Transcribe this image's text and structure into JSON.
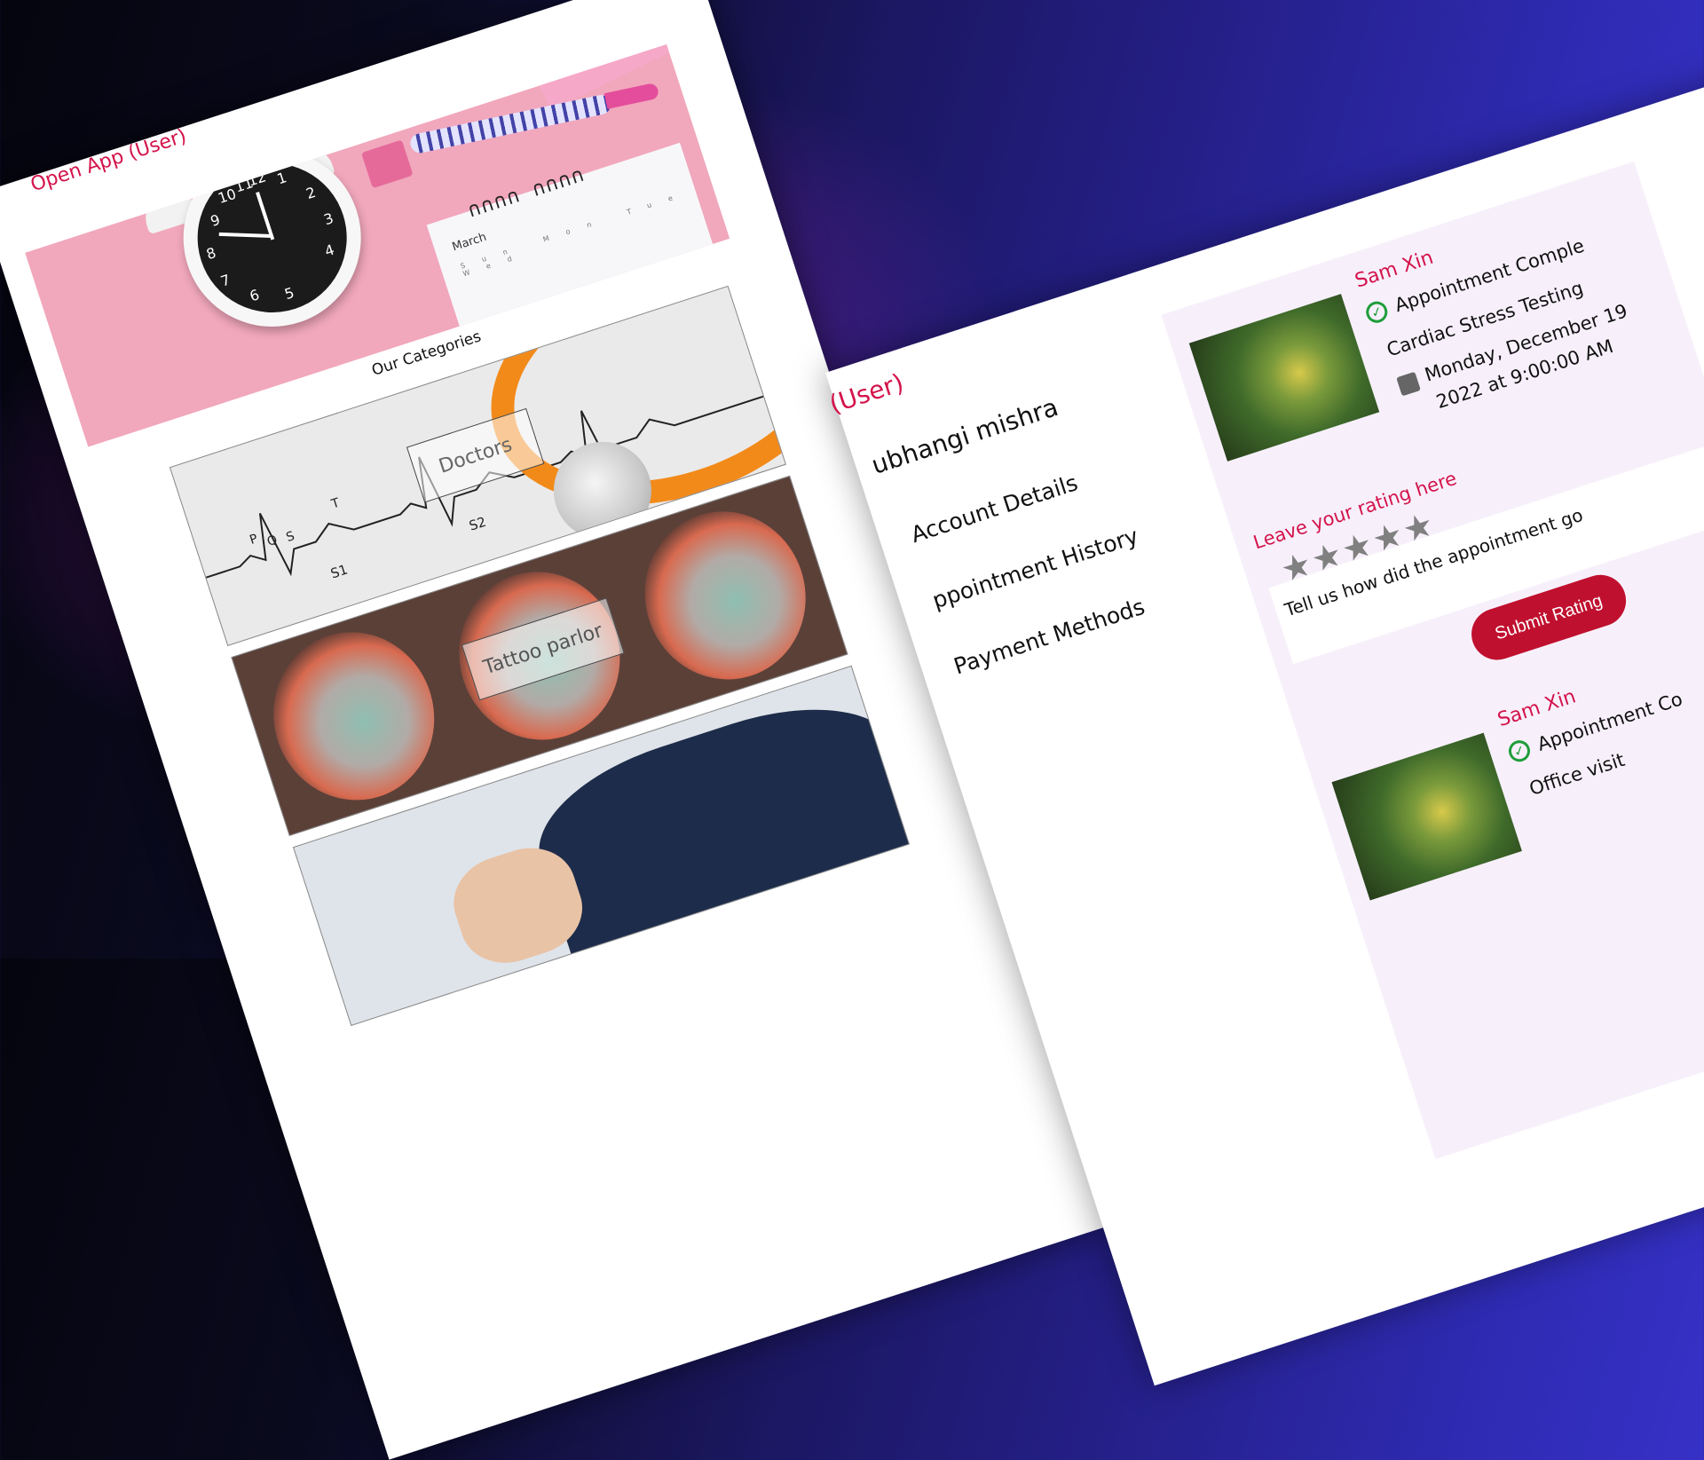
{
  "left_app": {
    "title": "Open App (User)",
    "hero": {
      "calendar_month": "March",
      "calendar_days": "Sun Mon Tue Wed",
      "clock_numbers": [
        "11",
        "12",
        "1",
        "2",
        "3",
        "4",
        "5",
        "6",
        "7",
        "8",
        "9",
        "10"
      ]
    },
    "categories_title": "Our Categories",
    "categories": [
      {
        "label": "Doctors"
      },
      {
        "label": "Tattoo parlor"
      },
      {
        "label": ""
      }
    ],
    "ekg_labels": [
      "P",
      "Q",
      "S",
      "T",
      "S1",
      "S2"
    ]
  },
  "right_app": {
    "title_fragment": "(User)",
    "user_name": "ubhangi mishra",
    "menu": [
      {
        "label": "Account Details"
      },
      {
        "label": "ppointment History"
      },
      {
        "label": "Payment Methods"
      }
    ],
    "appointments": [
      {
        "provider": "Sam Xin",
        "status": "Appointment Comple",
        "service": "Cardiac Stress Testing",
        "date_line1": "Monday, December 19",
        "date_line2": "2022 at 9:00:00 AM",
        "rating_label": "Leave your rating here",
        "stars": "★★★★★",
        "feedback_placeholder": "Tell us how did the appointment go",
        "submit_label": "Submit Rating"
      },
      {
        "provider": "Sam Xin",
        "status": "Appointment Co",
        "service": "Office visit"
      }
    ]
  },
  "colors": {
    "accent": "#d4134b",
    "button": "#c0102f",
    "success": "#1f9d3a",
    "star": "#808080"
  }
}
